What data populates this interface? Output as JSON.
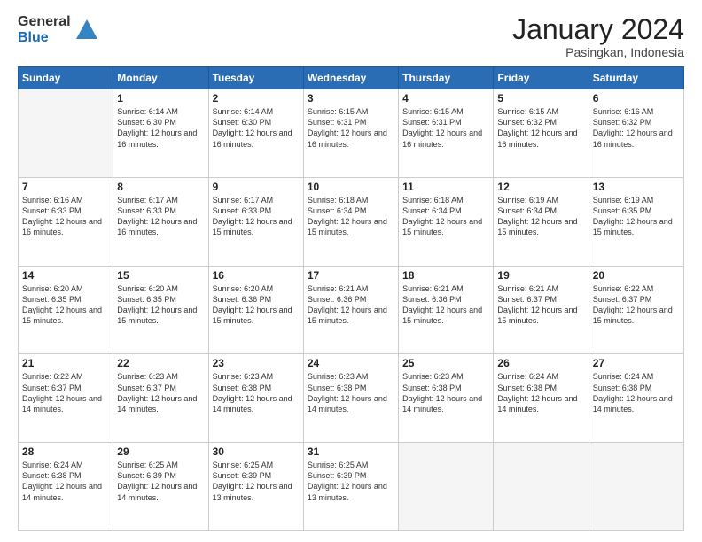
{
  "header": {
    "logo_general": "General",
    "logo_blue": "Blue",
    "month_title": "January 2024",
    "subtitle": "Pasingkan, Indonesia"
  },
  "days_of_week": [
    "Sunday",
    "Monday",
    "Tuesday",
    "Wednesday",
    "Thursday",
    "Friday",
    "Saturday"
  ],
  "weeks": [
    [
      {
        "day": "",
        "sunrise": "",
        "sunset": "",
        "daylight": ""
      },
      {
        "day": "1",
        "sunrise": "6:14 AM",
        "sunset": "6:30 PM",
        "daylight": "12 hours and 16 minutes."
      },
      {
        "day": "2",
        "sunrise": "6:14 AM",
        "sunset": "6:30 PM",
        "daylight": "12 hours and 16 minutes."
      },
      {
        "day": "3",
        "sunrise": "6:15 AM",
        "sunset": "6:31 PM",
        "daylight": "12 hours and 16 minutes."
      },
      {
        "day": "4",
        "sunrise": "6:15 AM",
        "sunset": "6:31 PM",
        "daylight": "12 hours and 16 minutes."
      },
      {
        "day": "5",
        "sunrise": "6:15 AM",
        "sunset": "6:32 PM",
        "daylight": "12 hours and 16 minutes."
      },
      {
        "day": "6",
        "sunrise": "6:16 AM",
        "sunset": "6:32 PM",
        "daylight": "12 hours and 16 minutes."
      }
    ],
    [
      {
        "day": "7",
        "sunrise": "6:16 AM",
        "sunset": "6:33 PM",
        "daylight": "12 hours and 16 minutes."
      },
      {
        "day": "8",
        "sunrise": "6:17 AM",
        "sunset": "6:33 PM",
        "daylight": "12 hours and 16 minutes."
      },
      {
        "day": "9",
        "sunrise": "6:17 AM",
        "sunset": "6:33 PM",
        "daylight": "12 hours and 15 minutes."
      },
      {
        "day": "10",
        "sunrise": "6:18 AM",
        "sunset": "6:34 PM",
        "daylight": "12 hours and 15 minutes."
      },
      {
        "day": "11",
        "sunrise": "6:18 AM",
        "sunset": "6:34 PM",
        "daylight": "12 hours and 15 minutes."
      },
      {
        "day": "12",
        "sunrise": "6:19 AM",
        "sunset": "6:34 PM",
        "daylight": "12 hours and 15 minutes."
      },
      {
        "day": "13",
        "sunrise": "6:19 AM",
        "sunset": "6:35 PM",
        "daylight": "12 hours and 15 minutes."
      }
    ],
    [
      {
        "day": "14",
        "sunrise": "6:20 AM",
        "sunset": "6:35 PM",
        "daylight": "12 hours and 15 minutes."
      },
      {
        "day": "15",
        "sunrise": "6:20 AM",
        "sunset": "6:35 PM",
        "daylight": "12 hours and 15 minutes."
      },
      {
        "day": "16",
        "sunrise": "6:20 AM",
        "sunset": "6:36 PM",
        "daylight": "12 hours and 15 minutes."
      },
      {
        "day": "17",
        "sunrise": "6:21 AM",
        "sunset": "6:36 PM",
        "daylight": "12 hours and 15 minutes."
      },
      {
        "day": "18",
        "sunrise": "6:21 AM",
        "sunset": "6:36 PM",
        "daylight": "12 hours and 15 minutes."
      },
      {
        "day": "19",
        "sunrise": "6:21 AM",
        "sunset": "6:37 PM",
        "daylight": "12 hours and 15 minutes."
      },
      {
        "day": "20",
        "sunrise": "6:22 AM",
        "sunset": "6:37 PM",
        "daylight": "12 hours and 15 minutes."
      }
    ],
    [
      {
        "day": "21",
        "sunrise": "6:22 AM",
        "sunset": "6:37 PM",
        "daylight": "12 hours and 14 minutes."
      },
      {
        "day": "22",
        "sunrise": "6:23 AM",
        "sunset": "6:37 PM",
        "daylight": "12 hours and 14 minutes."
      },
      {
        "day": "23",
        "sunrise": "6:23 AM",
        "sunset": "6:38 PM",
        "daylight": "12 hours and 14 minutes."
      },
      {
        "day": "24",
        "sunrise": "6:23 AM",
        "sunset": "6:38 PM",
        "daylight": "12 hours and 14 minutes."
      },
      {
        "day": "25",
        "sunrise": "6:23 AM",
        "sunset": "6:38 PM",
        "daylight": "12 hours and 14 minutes."
      },
      {
        "day": "26",
        "sunrise": "6:24 AM",
        "sunset": "6:38 PM",
        "daylight": "12 hours and 14 minutes."
      },
      {
        "day": "27",
        "sunrise": "6:24 AM",
        "sunset": "6:38 PM",
        "daylight": "12 hours and 14 minutes."
      }
    ],
    [
      {
        "day": "28",
        "sunrise": "6:24 AM",
        "sunset": "6:38 PM",
        "daylight": "12 hours and 14 minutes."
      },
      {
        "day": "29",
        "sunrise": "6:25 AM",
        "sunset": "6:39 PM",
        "daylight": "12 hours and 14 minutes."
      },
      {
        "day": "30",
        "sunrise": "6:25 AM",
        "sunset": "6:39 PM",
        "daylight": "12 hours and 13 minutes."
      },
      {
        "day": "31",
        "sunrise": "6:25 AM",
        "sunset": "6:39 PM",
        "daylight": "12 hours and 13 minutes."
      },
      {
        "day": "",
        "sunrise": "",
        "sunset": "",
        "daylight": ""
      },
      {
        "day": "",
        "sunrise": "",
        "sunset": "",
        "daylight": ""
      },
      {
        "day": "",
        "sunrise": "",
        "sunset": "",
        "daylight": ""
      }
    ]
  ]
}
